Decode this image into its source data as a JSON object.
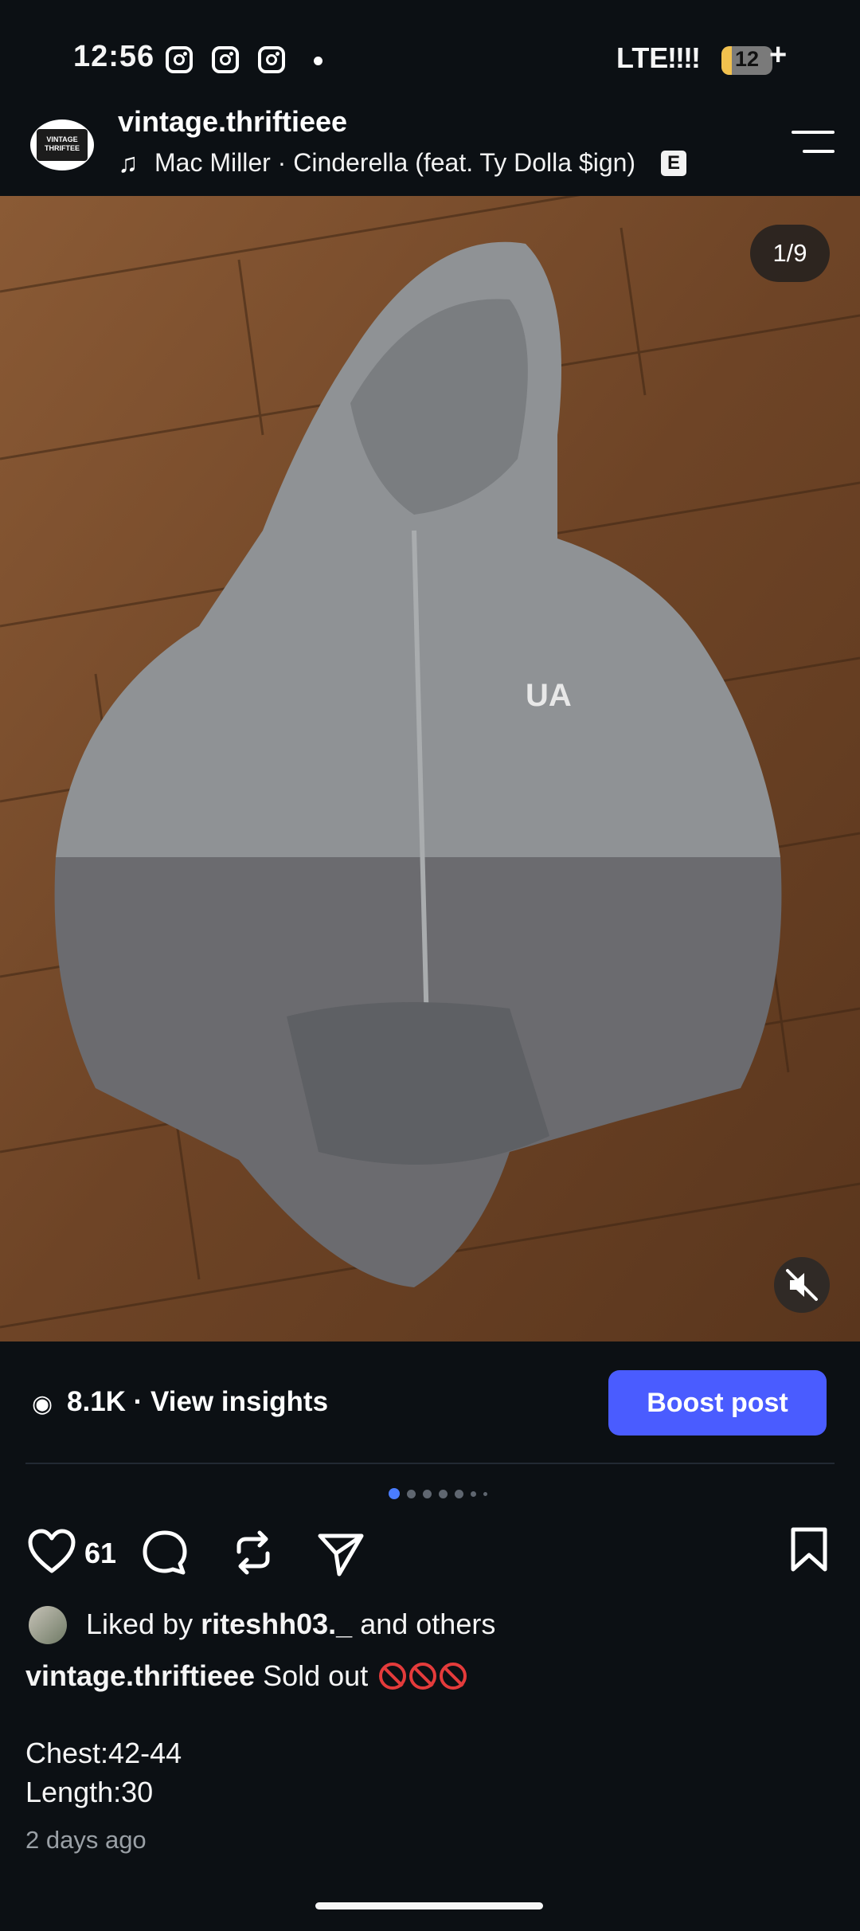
{
  "status_bar": {
    "time": "12:56",
    "network": "LTE",
    "signal": "!!!!",
    "battery": "12",
    "battery_plus": "+"
  },
  "header": {
    "username": "vintage.thriftieee",
    "avatar_text": "VINTAGE THRIFTEE",
    "music": "Mac Miller · Cinderella (feat. Ty Dolla $ign)",
    "explicit_badge": "E"
  },
  "photo": {
    "counter": "1/9",
    "subject": "gray zip-up hooded jacket on wooden floor"
  },
  "insights": {
    "text": "8.1K · View insights",
    "boost_label": "Boost post"
  },
  "carousel": {
    "total_dots": 7,
    "active_index": 0
  },
  "actions": {
    "likes_count": "61"
  },
  "liked_by": {
    "prefix": "Liked by",
    "user": "riteshh03._",
    "suffix": "and others"
  },
  "caption": {
    "username": "vintage.thriftieee",
    "text": "Sold out",
    "line1": "Chest:42-44",
    "line2": "Length:30"
  },
  "timestamp": "2 days ago",
  "colors": {
    "background": "#0c1014",
    "boost": "#4a5cff",
    "active_dot": "#4a7dff",
    "no_sign": "#e43b3b"
  },
  "icons": [
    "instagram-icon",
    "music-note-icon",
    "menu-icon",
    "mute-icon",
    "eye-icon",
    "heart-icon",
    "comment-icon",
    "repost-icon",
    "share-icon",
    "bookmark-icon"
  ]
}
